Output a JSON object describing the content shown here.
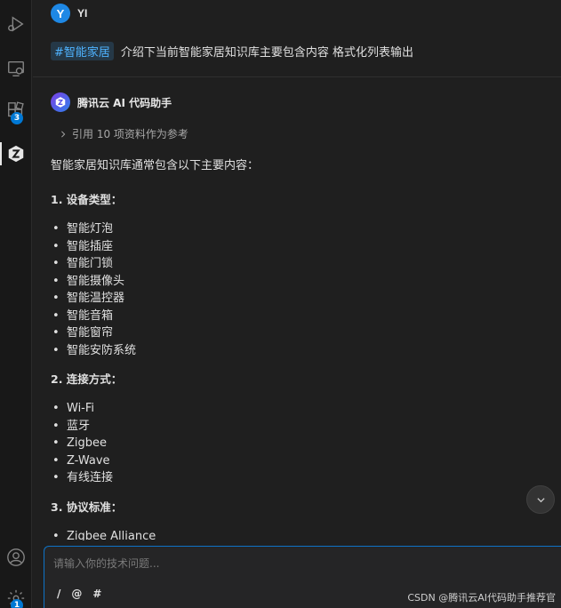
{
  "activity": {
    "extensions_badge": "3",
    "settings_badge": "1"
  },
  "user": {
    "avatar_letter": "Y",
    "name": "YI"
  },
  "user_message": {
    "tag": "#智能家居",
    "text": "介绍下当前智能家居知识库主要包含内容 格式化列表输出"
  },
  "assistant": {
    "name": "腾讯云 AI 代码助手",
    "refs_label": "引用 10 项资料作为参考"
  },
  "answer": {
    "intro": "智能家居知识库通常包含以下主要内容：",
    "sections": [
      {
        "heading": "1. 设备类型：",
        "items": [
          "智能灯泡",
          "智能插座",
          "智能门锁",
          "智能摄像头",
          "智能温控器",
          "智能音箱",
          "智能窗帘",
          "智能安防系统"
        ]
      },
      {
        "heading": "2. 连接方式：",
        "items": [
          "Wi-Fi",
          "蓝牙",
          "Zigbee",
          "Z-Wave",
          "有线连接"
        ]
      },
      {
        "heading": "3. 协议标准：",
        "items": [
          "Zigbee Alliance"
        ]
      }
    ]
  },
  "input": {
    "placeholder": "请输入你的技术问题...",
    "tool_slash": "/",
    "tool_at": "@",
    "tool_hash": "#"
  },
  "watermark": "CSDN @腾讯云AI代码助手推荐官",
  "colors": {
    "accent": "#0078d4",
    "tag_text": "#4fb3ff",
    "avatar": "#1e88e5"
  }
}
